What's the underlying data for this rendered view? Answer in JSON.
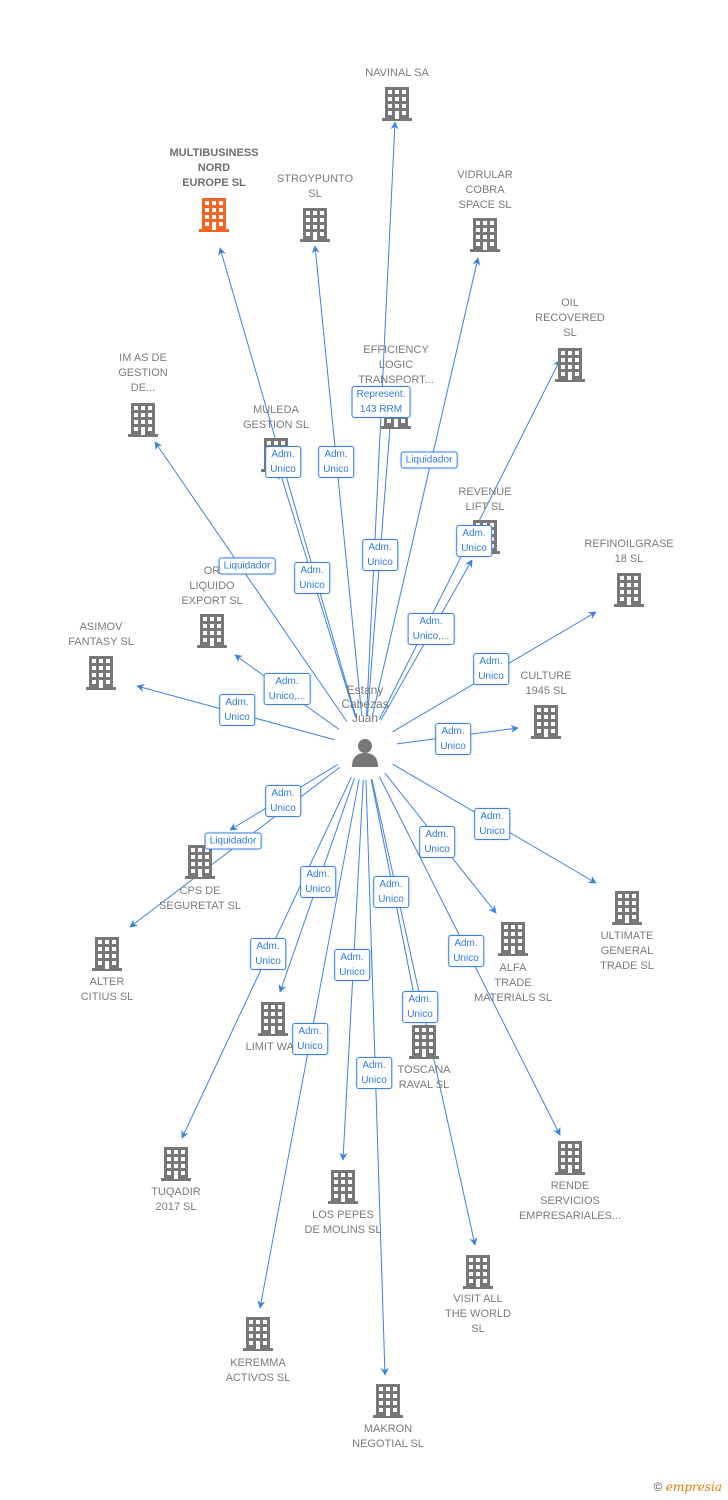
{
  "center": {
    "name": "Estany\nCabezas\nJuan",
    "icon": "person-icon"
  },
  "colors": {
    "edge": "#3b82e0",
    "node": "#777777",
    "highlight": "#f26522"
  },
  "nodes": [
    {
      "name": "NAVINAL SA",
      "role": "Adm.\nUnico"
    },
    {
      "name": "MULTIBUSINESS\nNORD\nEUROPE  SL",
      "role": "Adm.\nUnico",
      "highlighted": true
    },
    {
      "name": "STROYPUNTO\nSL",
      "role": "Adm.\nUnico"
    },
    {
      "name": "VIDRULAR\nCOBRA\nSPACE SL",
      "role": "Liquidador"
    },
    {
      "name": "OIL\nRECOVERED\nSL",
      "role": "Adm.\nUnico"
    },
    {
      "name": "EFFICIENCY\nLOGIC\nTRANSPORT...",
      "role": "Represent.\n143 RRM"
    },
    {
      "name": "IM AS DE\nGESTION\nDE...",
      "role": "Liquidador"
    },
    {
      "name": "MULEDA\nGESTION  SL",
      "role": "Adm.\nUnico"
    },
    {
      "name": "REVENUE\nLIFT  SL",
      "role": "Adm.\nUnico,..."
    },
    {
      "name": "OR\nLIQUIDO\nEXPORT  SL",
      "role": "Adm.\nUnico,..."
    },
    {
      "name": "ASIMOV\nFANTASY  SL",
      "role": "Adm.\nUnico"
    },
    {
      "name": "REFINOILGRASE\n18  SL",
      "role": "Adm.\nUnico"
    },
    {
      "name": "CULTURE\n1945  SL",
      "role": "Adm.\nUnico"
    },
    {
      "name": "CPS DE\nSEGURETAT SL",
      "role": "Adm.\nUnico"
    },
    {
      "name": "ALTER\nCITIUS  SL",
      "role": "Liquidador"
    },
    {
      "name": "ULTIMATE\nGENERAL\nTRADE  SL",
      "role": "Adm.\nUnico"
    },
    {
      "name": "ALFA\nTRADE\nMATERIALS  SL",
      "role": "Adm.\nUnico"
    },
    {
      "name": "LIMIT WAY",
      "role": "Adm.\nUnico"
    },
    {
      "name": "TOSCANA\nRAVAL  SL",
      "role": "Adm.\nUnico"
    },
    {
      "name": "TUQADIR\n2017  SL",
      "role": "Adm.\nUnico"
    },
    {
      "name": "RENDE\nSERVICIOS\nEMPRESARIALES...",
      "role": "Adm.\nUnico"
    },
    {
      "name": "LOS PEPES\nDE MOLINS  SL",
      "role": "Adm.\nUnico"
    },
    {
      "name": "VISIT ALL\nTHE WORLD\nSL",
      "role": "Adm.\nUnico"
    },
    {
      "name": "KEREMMA\nACTIVOS  SL",
      "role": "Adm.\nUnico"
    },
    {
      "name": "MAKRON\nNEGOTIAL  SL",
      "role": "Adm.\nUnico"
    }
  ],
  "footer": {
    "copyright": "©",
    "brand": "empresia"
  }
}
